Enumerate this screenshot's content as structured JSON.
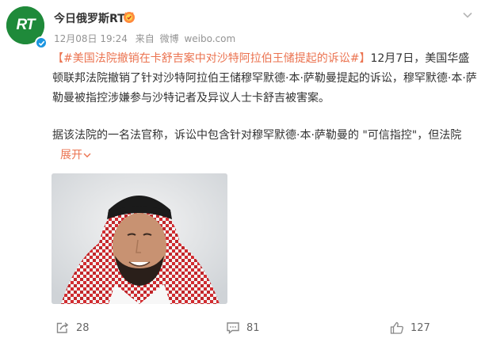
{
  "account": {
    "avatar_text": "RT",
    "username": "今日俄罗斯RT",
    "timestamp": "12月08日 19:24",
    "source_prefix": "来自",
    "source_app": "微博",
    "source_site": "weibo.com"
  },
  "post": {
    "topic": "【#美国法院撤销在卡舒吉案中对沙特阿拉伯王储提起的诉讼#】",
    "body1": "12月7日，美国华盛顿联邦法院撤销了针对沙特阿拉伯王储穆罕默德·本·萨勒曼提起的诉讼，穆罕默德·本·萨勒曼被指控涉嫌参与沙特记者及异议人士卡舒吉被害案。",
    "body2": "据该法院的一名法官称，诉讼中包含针对穆罕默德·本·萨勒曼的 \"可信指控\"，但法院",
    "expand_label": "展开"
  },
  "actions": {
    "repost_count": "28",
    "comment_count": "81",
    "like_count": "127"
  },
  "colors": {
    "topic_orange": "#eb7350",
    "avatar_green": "#1f8a3a",
    "verified_blue": "#1b95e0",
    "meta_gray": "#939393"
  },
  "icons": [
    "verified-check-icon",
    "fan-badge-icon",
    "chevron-down-icon",
    "repost-icon",
    "comment-icon",
    "like-icon",
    "expand-chevron-icon"
  ]
}
